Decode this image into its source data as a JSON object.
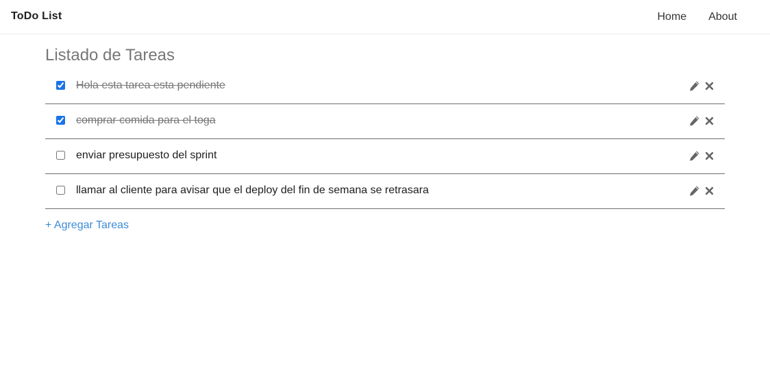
{
  "navbar": {
    "brand": "ToDo List",
    "links": [
      "Home",
      "About"
    ]
  },
  "main": {
    "title": "Listado de Tareas",
    "tasks": [
      {
        "text": "Hola esta tarea esta pendiente",
        "done": true
      },
      {
        "text": "comprar comida para el toga",
        "done": true
      },
      {
        "text": "enviar presupuesto del sprint",
        "done": false
      },
      {
        "text": "llamar al cliente para avisar que el deploy del fin de semana se retrasara",
        "done": false
      }
    ],
    "add_label": "+ Agregar Tareas"
  },
  "icons": {
    "edit": "pencil-icon",
    "delete": "close-icon"
  },
  "colors": {
    "accent": "#3d8bd9",
    "checkbox": "#1a73e8",
    "title": "#777777",
    "icon": "#666666"
  }
}
